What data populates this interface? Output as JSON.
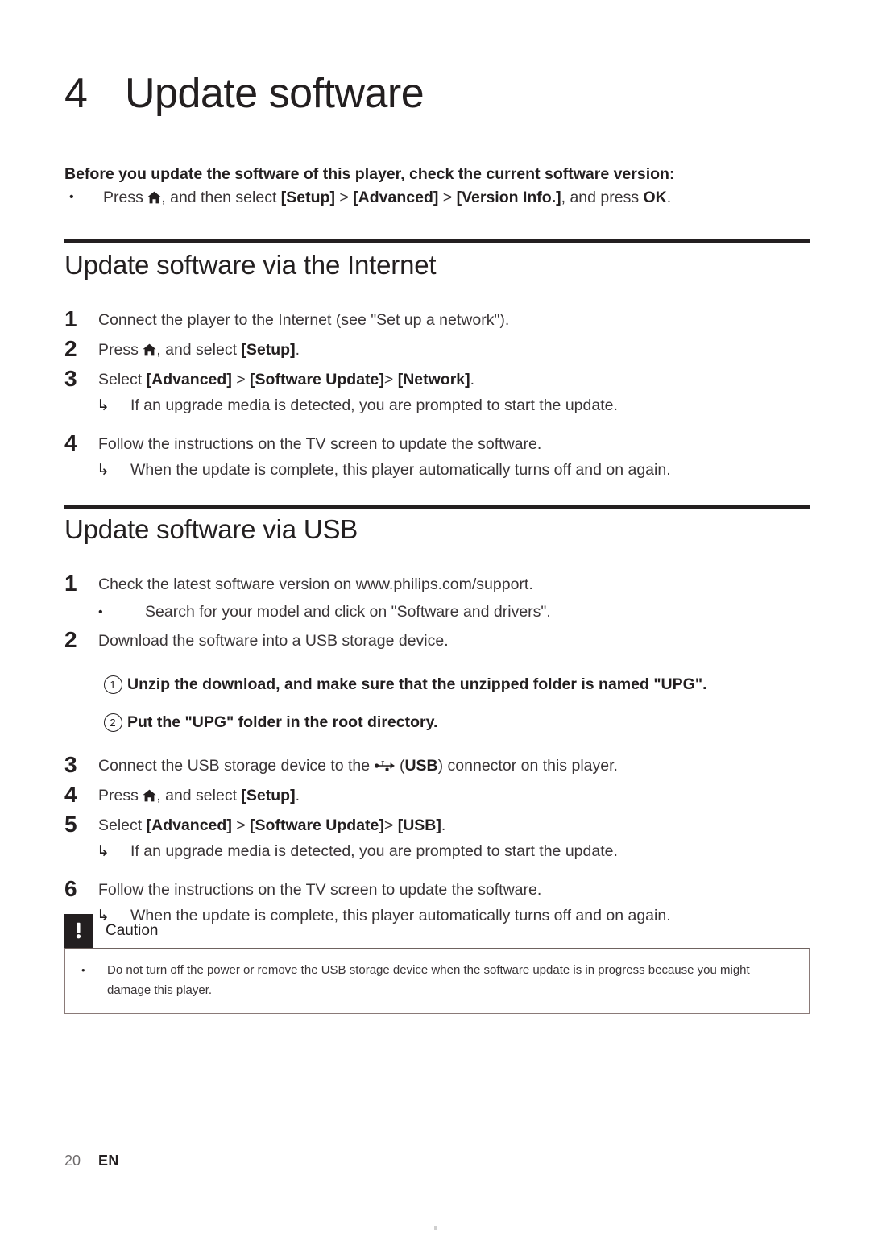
{
  "chapter": {
    "number": "4",
    "title": "Update software"
  },
  "intro": {
    "lead": "Before you update the software of this player, check the current software version:",
    "bullet_mark": "•",
    "bullet": {
      "pre": "Press ",
      "icon": "home-icon",
      "mid": ", and then select ",
      "menu1": "[Setup]",
      "sep1": " > ",
      "menu2": "[Advanced]",
      "sep2": " > ",
      "menu3": "[Version Info.]",
      "post": ", and press ",
      "key": "OK",
      "end": "."
    }
  },
  "sections": [
    {
      "heading": "Update software via the Internet",
      "steps": [
        {
          "num": "1",
          "text": "Connect the player to the Internet (see \"Set up a network\")."
        },
        {
          "num": "2",
          "pre": "Press ",
          "icon": "home-icon",
          "mid": ", and select ",
          "bold1": "[Setup]",
          "end": "."
        },
        {
          "num": "3",
          "pre": "Select ",
          "bold1": "[Advanced]",
          "sep1": " > ",
          "bold2": "[Software Update]",
          "sep2": "> ",
          "bold3": "[Network]",
          "end": ".",
          "note": "If an upgrade media is detected, you are prompted to start the update."
        },
        {
          "num": "4",
          "text": "Follow the instructions on the TV screen to update the software.",
          "note": "When the update is complete, this player automatically turns off and on again."
        }
      ]
    },
    {
      "heading": "Update software via USB",
      "steps": [
        {
          "num": "1",
          "text": "Check the latest software version on www.philips.com/support.",
          "sub_bullet_mark": "•",
          "sub_bullet": "Search for your model and click on \"Software and drivers\"."
        },
        {
          "num": "2",
          "text": "Download the software into a USB storage device.",
          "circled": [
            {
              "n": "1",
              "text": "Unzip the download, and make sure that the unzipped folder is named \"UPG\"."
            },
            {
              "n": "2",
              "text": "Put the \"UPG\" folder in the root directory."
            }
          ]
        },
        {
          "num": "3",
          "pre": "Connect the USB storage device to the ",
          "icon": "usb-icon",
          "mid": " (",
          "bold1": "USB",
          "post": ") connector on this player."
        },
        {
          "num": "4",
          "pre": "Press ",
          "icon": "home-icon",
          "mid": ", and select ",
          "bold1": "[Setup]",
          "end": "."
        },
        {
          "num": "5",
          "pre": "Select ",
          "bold1": "[Advanced]",
          "sep1": " > ",
          "bold2": "[Software Update]",
          "sep2": "> ",
          "bold3": "[USB]",
          "end": ".",
          "note": "If an upgrade media is detected, you are prompted to start the update."
        },
        {
          "num": "6",
          "text": "Follow the instructions on the TV screen to update the software.",
          "note": "When the update is complete, this player automatically turns off and on again."
        }
      ]
    }
  ],
  "note_mark": "↳",
  "caution": {
    "label": "Caution",
    "icon": "exclamation-icon",
    "bullet_mark": "•",
    "body": "Do not turn off the power or remove the USB storage device when the software update is in progress because you might damage this player."
  },
  "footer": {
    "page": "20",
    "language": "EN"
  },
  "colors": {
    "ink": "#231f20",
    "body": "#3a3537",
    "box_border": "#8a7a78",
    "page_number": "#6d6a6b"
  }
}
